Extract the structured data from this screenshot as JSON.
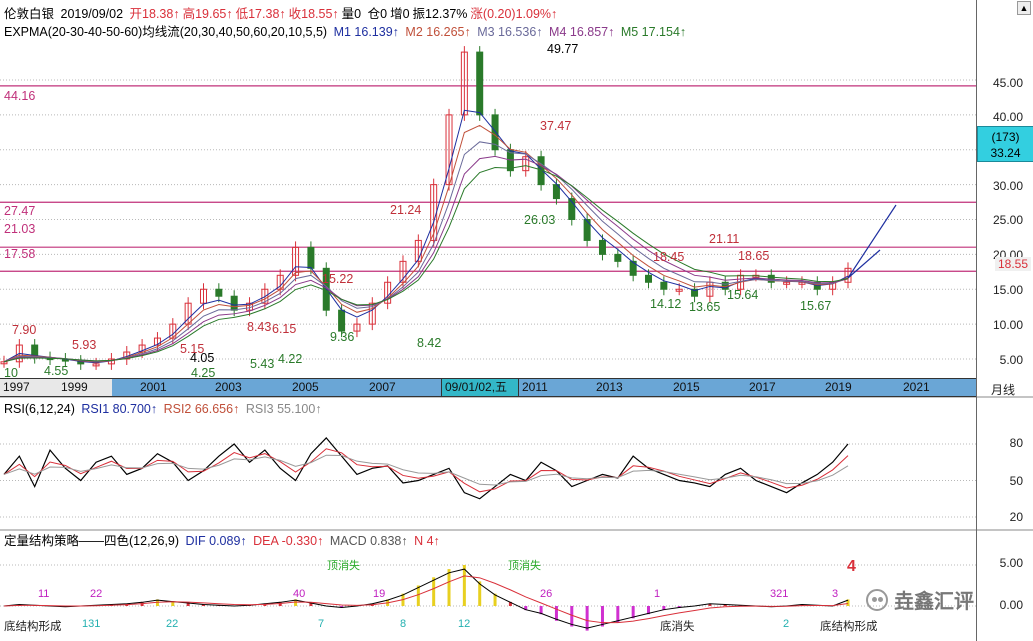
{
  "kline_header": {
    "name": "伦敦白银",
    "date": "2019/09/02",
    "open": "开18.38↑",
    "high": "高19.65↑",
    "low": "低17.38↑",
    "close": "收18.55↑",
    "vol": "量0",
    "pos": "仓0",
    "inc": "增0",
    "amp": "振12.37%",
    "chg": "涨(0.20)1.09%↑"
  },
  "expma_header": {
    "label": "EXPMA(20-30-40-50-60)均线流(20,30,40,50,60,20,10,5,5)",
    "m1": "M1 16.139↑",
    "m2": "M2 16.265↑",
    "m3": "M3 16.536↑",
    "m4": "M4 16.857↑",
    "m5": "M5 17.154↑"
  },
  "price_axis": [
    "45.00",
    "40.00",
    "35.00",
    "30.00",
    "25.00",
    "20.00",
    "15.00",
    "10.00",
    "5.00"
  ],
  "price_badge": {
    "count": "(173)",
    "value": "33.24"
  },
  "price_axis_current": "18.55",
  "hlines": [
    {
      "label": "44.16",
      "value": 44.16
    },
    {
      "label": "27.47",
      "value": 27.47
    },
    {
      "label": "21.03",
      "value": 21.03
    },
    {
      "label": "17.58",
      "value": 17.58
    }
  ],
  "annotations": [
    {
      "text": "49.77",
      "color": "#000"
    },
    {
      "text": "37.47",
      "color": "#c0303a"
    },
    {
      "text": "26.03",
      "color": "#2a7a2a"
    },
    {
      "text": "21.24",
      "color": "#c0303a"
    },
    {
      "text": "15.22",
      "color": "#c0303a"
    },
    {
      "text": "8.42",
      "color": "#2a7a2a"
    },
    {
      "text": "9.36",
      "color": "#2a7a2a"
    },
    {
      "text": "8.43",
      "color": "#c0303a"
    },
    {
      "text": "6.15",
      "color": "#c0303a"
    },
    {
      "text": "5.43",
      "color": "#2a7a2a"
    },
    {
      "text": "4.22",
      "color": "#2a7a2a"
    },
    {
      "text": "5.15",
      "color": "#c0303a"
    },
    {
      "text": "4.05",
      "color": "#000"
    },
    {
      "text": "4.25",
      "color": "#2a7a2a"
    },
    {
      "text": "7.90",
      "color": "#c0303a"
    },
    {
      "text": "5.93",
      "color": "#c0303a"
    },
    {
      "text": "4.55",
      "color": "#2a7a2a"
    },
    {
      "text": "10",
      "color": "#2a7a2a"
    },
    {
      "text": "21.11",
      "color": "#c0303a"
    },
    {
      "text": "18.65",
      "color": "#c0303a"
    },
    {
      "text": "18.45",
      "color": "#c0303a"
    },
    {
      "text": "14.12",
      "color": "#2a7a2a"
    },
    {
      "text": "13.65",
      "color": "#2a7a2a"
    },
    {
      "text": "15.64",
      "color": "#2a7a2a"
    },
    {
      "text": "15.67",
      "color": "#2a7a2a"
    }
  ],
  "time_axis": {
    "years": [
      "1997",
      "1999",
      "2001",
      "2003",
      "2005",
      "2007",
      "2011",
      "2013",
      "2015",
      "2017",
      "2019",
      "2021"
    ],
    "cursor": "09/01/02,五",
    "period": "月线"
  },
  "rsi_header": {
    "label": "RSI(6,12,24)",
    "rsi1": "RSI1 80.700↑",
    "rsi2": "RSI2 66.656↑",
    "rsi3": "RSI3 55.100↑"
  },
  "rsi_axis": [
    "80",
    "50",
    "20"
  ],
  "macd_header": {
    "label": "定量结构策略——四色(12,26,9)",
    "dif": "DIF 0.089↑",
    "dea": "DEA -0.330↑",
    "macd": "MACD 0.838↑",
    "n": "N 4↑"
  },
  "macd_axis": [
    "5.00",
    "0.00"
  ],
  "macd_labels": {
    "top1": "顶消失",
    "top2": "顶消失",
    "bottom_form_left": "底结构形成",
    "bottom_form_right": "底结构形成",
    "bottom_vanish": "底消失",
    "big_n": "4",
    "counts": [
      "11",
      "22",
      "40",
      "19",
      "26",
      "1",
      "321",
      "3"
    ],
    "bottom_counts": [
      "131",
      "22",
      "7",
      "8",
      "12",
      "2"
    ]
  },
  "watermark": "垚鑫汇评",
  "colors": {
    "up": "#d9303a",
    "down": "#2a7a2a",
    "m1": "#1e2fa0",
    "m2": "#c0503a",
    "m3": "#6a6a9a",
    "m4": "#8a3a8a",
    "m5": "#2a7a2a",
    "hline": "#c0307a",
    "grid": "#b8b8b8",
    "timebar": "#6aa6d6",
    "cursor": "#33b7c8"
  }
}
